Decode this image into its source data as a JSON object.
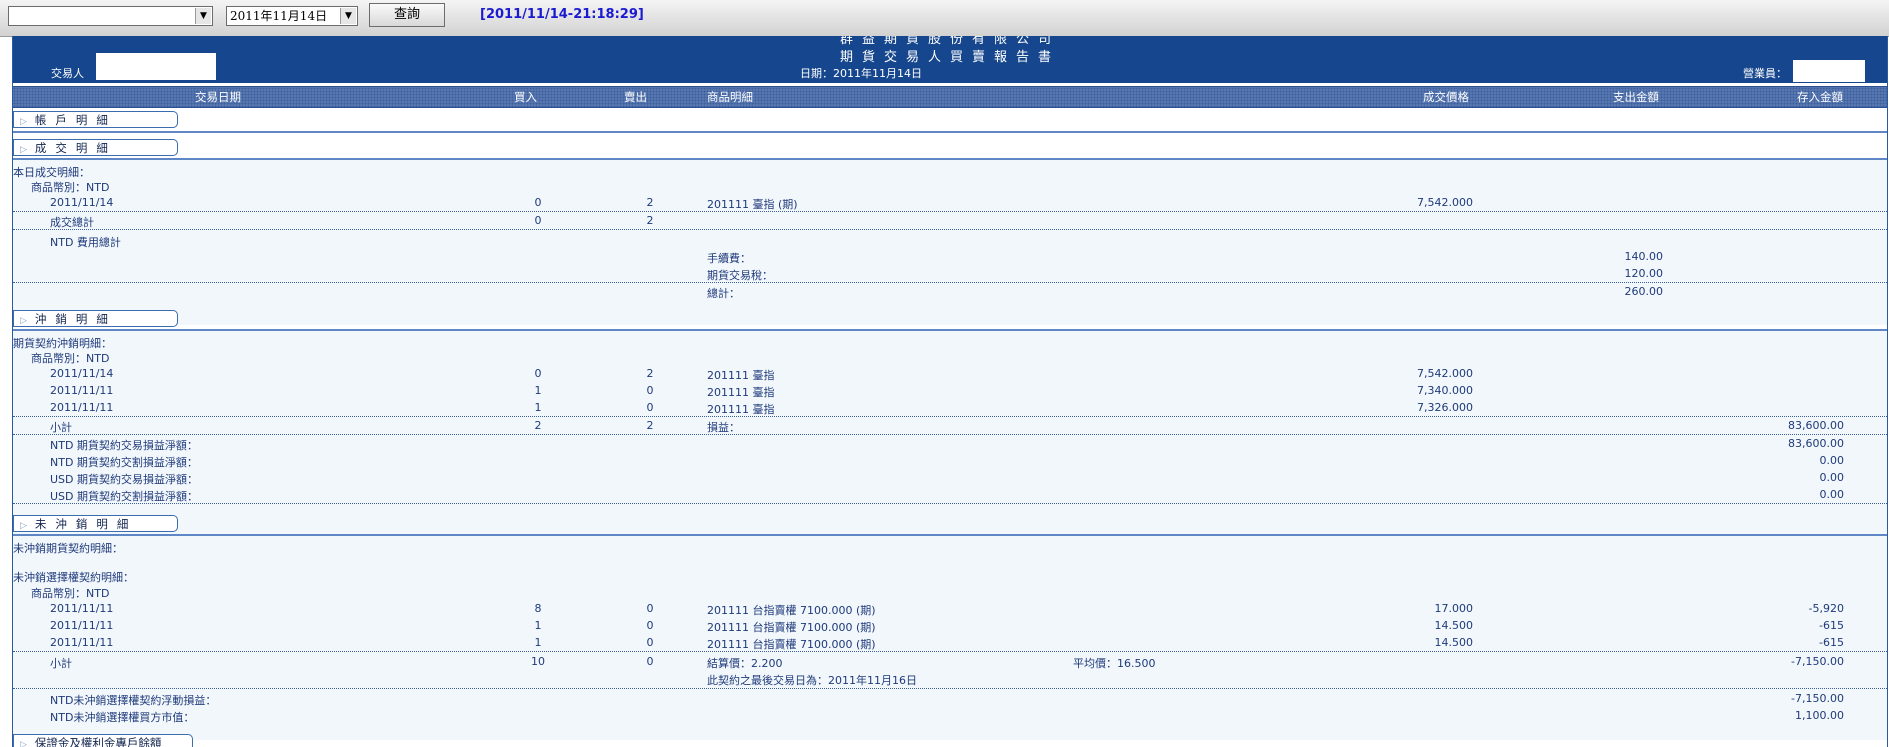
{
  "toolbar": {
    "account_select": "",
    "date_select": "2011年11月14日",
    "query_label": "查詢",
    "timestamp": "[2011/11/14-21:18:29]"
  },
  "header": {
    "company": "群益期貨股份有限公司",
    "title": "期貨交易人買賣報告書",
    "trader_label": "交易人",
    "date_label": "日期：2011年11月14日",
    "sales_label": "營業員："
  },
  "columns": {
    "date": "交易日期",
    "buy": "買入",
    "sell": "賣出",
    "product": "商品明細",
    "price": "成交價格",
    "debit": "支出金額",
    "credit": "存入金額"
  },
  "sections": {
    "account": "帳戶明細",
    "trades": "成交明細",
    "offset": "沖銷明細",
    "open": "未沖銷明細",
    "margin": "保證金及權利金專戶餘額"
  },
  "trades": {
    "today_label": "本日成交明細：",
    "currency_label": "商品幣別：NTD",
    "rows": [
      {
        "date": "2011/11/14",
        "buy": "0",
        "sell": "2",
        "product": "201111 臺指 (期)",
        "price": "7,542.000"
      }
    ],
    "total_label": "成交總計",
    "total_buy": "0",
    "total_sell": "2",
    "fee_title": "NTD 費用總計",
    "fee_label": "手續費：",
    "fee_value": "140.00",
    "tax_label": "期貨交易稅：",
    "tax_value": "120.00",
    "sum_label": "總計：",
    "sum_value": "260.00"
  },
  "offset": {
    "title": "期貨契約沖銷明細：",
    "currency_label": "商品幣別：NTD",
    "rows": [
      {
        "date": "2011/11/14",
        "buy": "0",
        "sell": "2",
        "product": "201111 臺指",
        "price": "7,542.000"
      },
      {
        "date": "2011/11/11",
        "buy": "1",
        "sell": "0",
        "product": "201111 臺指",
        "price": "7,340.000"
      },
      {
        "date": "2011/11/11",
        "buy": "1",
        "sell": "0",
        "product": "201111 臺指",
        "price": "7,326.000"
      }
    ],
    "subtotal_label": "小計",
    "subtotal_buy": "2",
    "subtotal_sell": "2",
    "pnl_label": "損益：",
    "pnl_value": "83,600.00",
    "net": [
      {
        "label": "NTD 期貨契約交易損益淨額：",
        "value": "83,600.00"
      },
      {
        "label": "NTD 期貨契約交割損益淨額：",
        "value": "0.00"
      },
      {
        "label": "USD 期貨契約交易損益淨額：",
        "value": "0.00"
      },
      {
        "label": "USD 期貨契約交割損益淨額：",
        "value": "0.00"
      }
    ]
  },
  "open": {
    "futures_title": "未沖銷期貨契約明細：",
    "options_title": "未沖銷選擇權契約明細：",
    "currency_label": "商品幣別：NTD",
    "rows": [
      {
        "date": "2011/11/11",
        "buy": "8",
        "sell": "0",
        "product": "201111 台指賣權 7100.000 (期)",
        "price": "17.000",
        "credit": "-5,920"
      },
      {
        "date": "2011/11/11",
        "buy": "1",
        "sell": "0",
        "product": "201111 台指賣權 7100.000 (期)",
        "price": "14.500",
        "credit": "-615"
      },
      {
        "date": "2011/11/11",
        "buy": "1",
        "sell": "0",
        "product": "201111 台指賣權 7100.000 (期)",
        "price": "14.500",
        "credit": "-615"
      }
    ],
    "subtotal_label": "小計",
    "subtotal_buy": "10",
    "subtotal_sell": "0",
    "settle_label": "結算價：2.200",
    "avg_label": "平均價：16.500",
    "subtotal_credit": "-7,150.00",
    "last_trade_note": "此契約之最後交易日為：2011年11月16日",
    "float_label": "NTD未沖銷選擇權契約浮動損益：",
    "float_value": "-7,150.00",
    "market_label": "NTD未沖銷選擇權買方市值：",
    "market_value": "1,100.00"
  }
}
